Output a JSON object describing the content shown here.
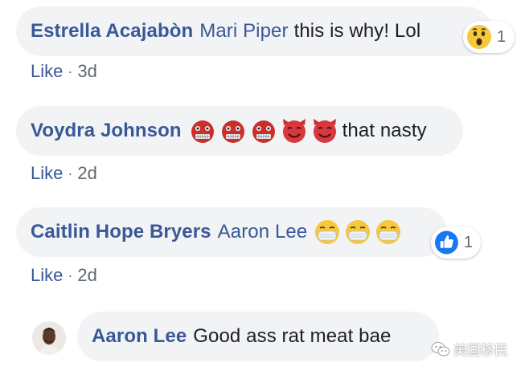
{
  "comments": [
    {
      "author": "Estrella Acajabòn",
      "tag": "Mari Piper",
      "text": "this is why! Lol",
      "like_label": "Like",
      "separator": "·",
      "time": "3d",
      "reaction": {
        "icon": "wow-emoji-icon",
        "count": "1"
      }
    },
    {
      "author": "Voydra Johnson",
      "text": "that nasty",
      "emojis": [
        "ogre-emoji-icon",
        "ogre-emoji-icon",
        "ogre-emoji-icon",
        "smiling-devil-emoji-icon",
        "smiling-devil-emoji-icon"
      ],
      "like_label": "Like",
      "separator": "·",
      "time": "2d"
    },
    {
      "author": "Caitlin Hope Bryers",
      "tag": "Aaron Lee",
      "emojis": [
        "medical-mask-emoji-icon",
        "medical-mask-emoji-icon",
        "medical-mask-emoji-icon"
      ],
      "like_label": "Like",
      "separator": "·",
      "time": "2d",
      "reaction": {
        "icon": "thumbs-up-icon",
        "count": "1"
      }
    },
    {
      "author": "Aaron Lee",
      "text": "Good ass rat meat bae",
      "avatar_icon": "avatar"
    }
  ],
  "watermark": {
    "icon": "wechat-icon",
    "text": "美国移民"
  },
  "colors": {
    "link_blue": "#385898",
    "bubble_bg": "#f2f3f5",
    "meta_gray": "#606770",
    "reaction_blue": "#1877f2"
  }
}
